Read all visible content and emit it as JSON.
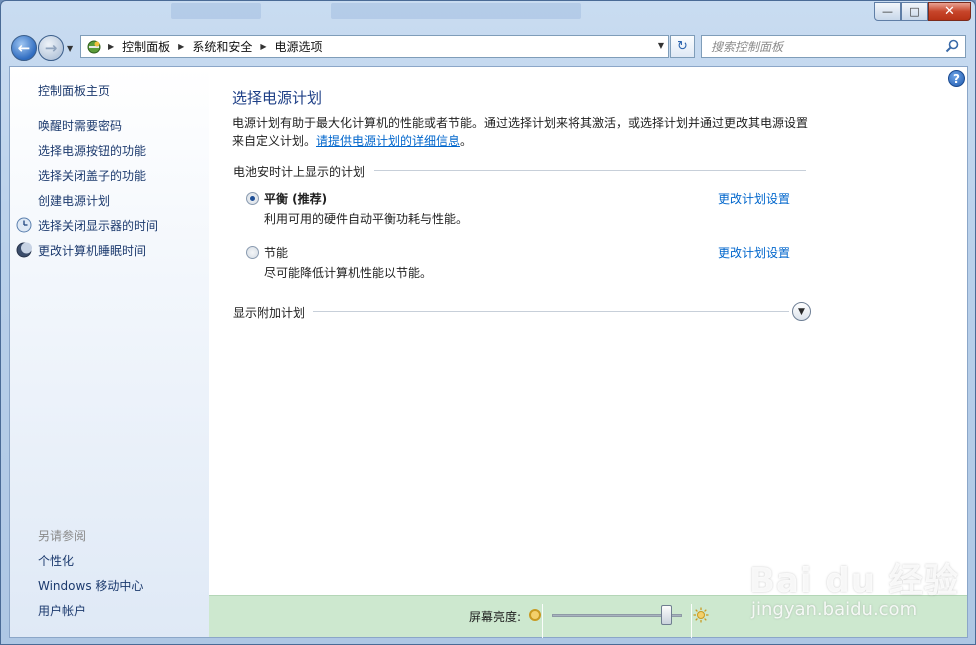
{
  "window": {
    "minimize": "—",
    "maximize": "□",
    "close": "✕"
  },
  "nav": {
    "back_icon": "arrow-left-icon",
    "forward_icon": "arrow-right-icon",
    "breadcrumb": [
      "控制面板",
      "系统和安全",
      "电源选项"
    ],
    "search_placeholder": "搜索控制面板"
  },
  "sidebar": {
    "home": "控制面板主页",
    "links": [
      "唤醒时需要密码",
      "选择电源按钮的功能",
      "选择关闭盖子的功能",
      "创建电源计划",
      "选择关闭显示器的时间",
      "更改计算机睡眠时间"
    ],
    "see_also_title": "另请参阅",
    "see_also": [
      "个性化",
      "Windows 移动中心",
      "用户帐户"
    ]
  },
  "main": {
    "title": "选择电源计划",
    "desc_line1": "电源计划有助于最大化计算机的性能或者节能。通过选择计划来将其激活，或选择计划并通过更改其电源设置",
    "desc_line2_prefix": "来自定义计划。",
    "desc_link": "请提供电源计划的详细信息",
    "desc_suffix": "。",
    "group_title": "电池安时计上显示的计划",
    "plans": [
      {
        "name": "平衡 (推荐)",
        "desc": "利用可用的硬件自动平衡功耗与性能。",
        "link": "更改计划设置",
        "selected": true
      },
      {
        "name": "节能",
        "desc": "尽可能降低计算机性能以节能。",
        "link": "更改计划设置",
        "selected": false
      }
    ],
    "extra_plans": "显示附加计划"
  },
  "brightness": {
    "label": "屏幕亮度:",
    "level": 0.92
  },
  "watermark": {
    "text": "Bai du 经验",
    "sub": "jingyan.baidu.com"
  },
  "colors": {
    "link": "#0066cc",
    "title": "#1e3f86",
    "brightness_bar": "#cde8cf"
  }
}
